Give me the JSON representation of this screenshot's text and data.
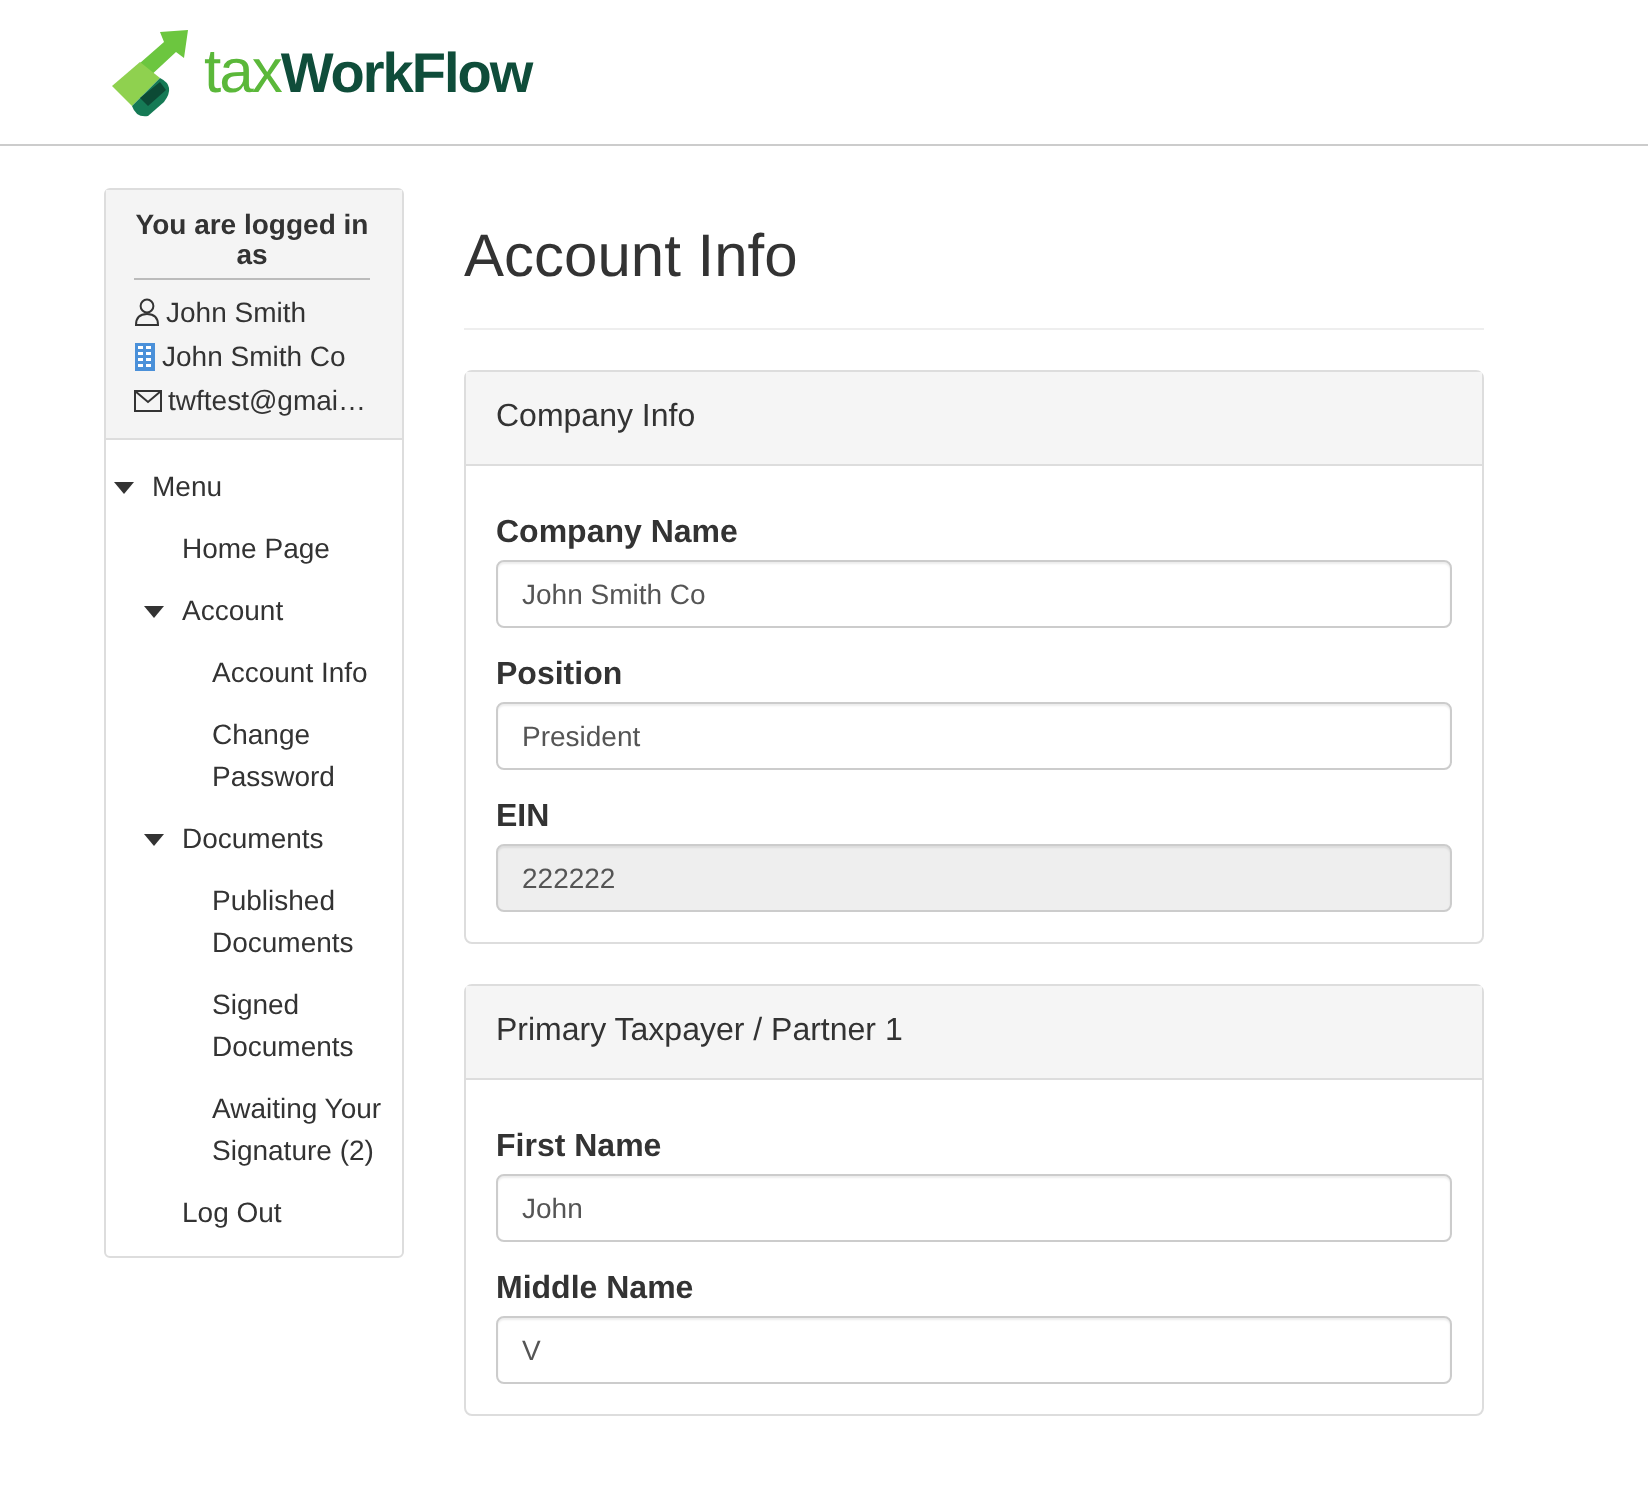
{
  "logo": {
    "part_1": "tax",
    "part_2": "WorkFlow"
  },
  "user_box": {
    "title": "You are logged in as",
    "name": "John Smith",
    "company": "John Smith Co",
    "email": "twftest@gmai…"
  },
  "menu": [
    {
      "label": "Menu",
      "expanded": true,
      "children": [
        {
          "label": "Home Page"
        },
        {
          "label": "Account",
          "expanded": true,
          "children": [
            {
              "label": "Account Info"
            },
            {
              "label": "Change Password"
            }
          ]
        },
        {
          "label": "Documents",
          "expanded": true,
          "children": [
            {
              "label": "Published Documents"
            },
            {
              "label": "Signed Documents"
            },
            {
              "label": "Awaiting Your Signature (2)"
            }
          ]
        },
        {
          "label": "Log Out"
        }
      ]
    }
  ],
  "page_title": "Account Info",
  "panels": [
    {
      "title": "Company Info",
      "fields": [
        {
          "label": "Company Name",
          "value": "John Smith Co",
          "disabled": false
        },
        {
          "label": "Position",
          "value": "President",
          "disabled": false
        },
        {
          "label": "EIN",
          "value": "222222",
          "disabled": true
        }
      ]
    },
    {
      "title": "Primary Taxpayer / Partner 1",
      "fields": [
        {
          "label": "First Name",
          "value": "John",
          "disabled": false
        },
        {
          "label": "Middle Name",
          "value": "V",
          "disabled": false
        }
      ]
    }
  ]
}
